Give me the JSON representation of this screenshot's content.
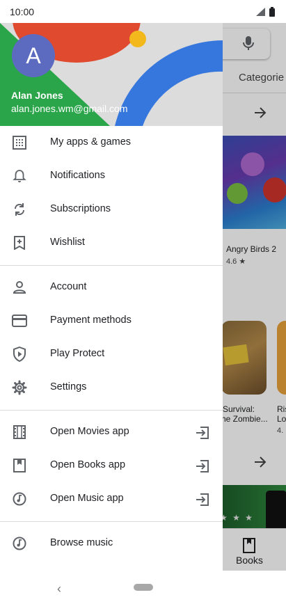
{
  "status_bar": {
    "time": "10:00"
  },
  "drawer": {
    "avatar_letter": "A",
    "user_name": "Alan Jones",
    "user_email": "alan.jones.wm@gmail.com",
    "sections": [
      [
        {
          "label": "My apps & games",
          "icon": "apps-grid-icon"
        },
        {
          "label": "Notifications",
          "icon": "bell-icon"
        },
        {
          "label": "Subscriptions",
          "icon": "refresh-icon"
        },
        {
          "label": "Wishlist",
          "icon": "bookmark-plus-icon"
        }
      ],
      [
        {
          "label": "Account",
          "icon": "person-icon"
        },
        {
          "label": "Payment methods",
          "icon": "credit-card-icon"
        },
        {
          "label": "Play Protect",
          "icon": "shield-play-icon"
        },
        {
          "label": "Settings",
          "icon": "gear-icon"
        }
      ],
      [
        {
          "label": "Open Movies app",
          "icon": "film-icon"
        },
        {
          "label": "Open Books app",
          "icon": "book-icon"
        },
        {
          "label": "Open Music app",
          "icon": "music-note-icon"
        }
      ],
      [
        {
          "label": "Browse music",
          "icon": "music-note-icon"
        }
      ]
    ]
  },
  "background_app": {
    "categories_label": "Categorie",
    "card1": {
      "title": "Angry Birds 2",
      "rating": "4.6 ★"
    },
    "card2": {
      "title_line1": "Survival:",
      "title_line2": "he Zombie..."
    },
    "card3": {
      "title_line1": "Ris",
      "title_line2": "Lo",
      "rating": "4."
    },
    "banner_stars": "★ ★ ★",
    "bottom_nav_label": "Books"
  }
}
